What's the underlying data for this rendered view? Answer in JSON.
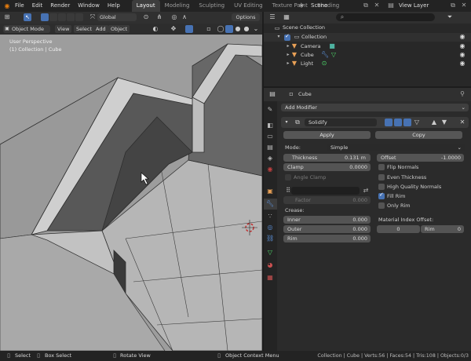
{
  "topbar": {
    "menus": [
      "File",
      "Edit",
      "Render",
      "Window",
      "Help"
    ],
    "workspaces": [
      "Layout",
      "Modeling",
      "Sculpting",
      "UV Editing",
      "Texture Paint",
      "Shading"
    ],
    "active_workspace": "Layout",
    "scene": "Scene",
    "view_layer": "View Layer"
  },
  "viewport": {
    "orientation": "Global",
    "options_label": "Options",
    "mode": "Object Mode",
    "menus": [
      "View",
      "Select",
      "Add",
      "Object"
    ],
    "info_line1": "User Perspective",
    "info_line2": "(1) Collection | Cube"
  },
  "outliner": {
    "root": "Scene Collection",
    "collection": "Collection",
    "items": [
      "Camera",
      "Cube",
      "Light"
    ]
  },
  "properties": {
    "object_name": "Cube",
    "add_modifier": "Add Modifier",
    "modifier_name": "Solidify",
    "apply_label": "Apply",
    "copy_label": "Copy",
    "mode_label": "Mode:",
    "mode_value": "Simple",
    "thickness_label": "Thickness",
    "thickness_value": "0.131 m",
    "offset_label": "Offset",
    "offset_value": "-1.0000",
    "clamp_label": "Clamp",
    "clamp_value": "0.0000",
    "angle_clamp": "Angle Clamp",
    "flip_normals": "Flip Normals",
    "even_thickness": "Even Thickness",
    "high_quality_normals": "High Quality Normals",
    "fill_rim": "Fill Rim",
    "only_rim": "Only Rim",
    "factor_label": "Factor",
    "factor_value": "0.000",
    "crease_label": "Crease:",
    "inner_label": "Inner",
    "inner_value": "0.000",
    "outer_label": "Outer",
    "outer_value": "0.000",
    "rim_label": "Rim",
    "rim_value": "0.000",
    "material_index_offset": "Material Index Offset:",
    "mat_offset_value": "0",
    "mat_rim_label": "Rim",
    "mat_rim_value": "0"
  },
  "statusbar": {
    "select": "Select",
    "box_select": "Box Select",
    "rotate_view": "Rotate View",
    "context_menu": "Object Context Menu",
    "stats": "Collection | Cube | Verts:56 | Faces:54 | Tris:108 | Objects:0/3"
  },
  "colors": {
    "accent": "#4772b3",
    "active_tab": "#3d3d3d",
    "panel": "#2b2b2b",
    "viewport_bg": "#9b9b9b"
  }
}
